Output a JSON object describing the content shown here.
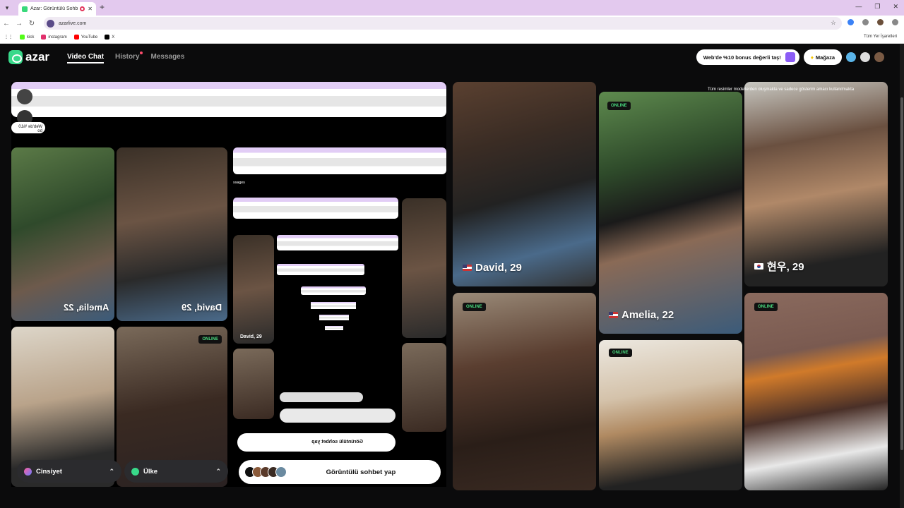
{
  "browser": {
    "tab_title": "Azar: Görüntülü Sohbet & R",
    "url": "azarlive.com",
    "bookmarks": [
      {
        "label": "kick",
        "color": "#53fc18"
      },
      {
        "label": "instagram",
        "color": "#e1306c"
      },
      {
        "label": "YouTube",
        "color": "#ff0000"
      },
      {
        "label": "X",
        "color": "#000000"
      }
    ],
    "all_bookmarks": "Tüm Yer İşaretleri"
  },
  "header": {
    "logo_text": "azar",
    "nav": [
      {
        "label": "Video Chat",
        "active": true
      },
      {
        "label": "History",
        "active": false,
        "dot": true
      },
      {
        "label": "Messages",
        "active": false
      }
    ],
    "bonus_label": "Web'de %10 bonus değerli taş!",
    "shop_label": "Mağaza"
  },
  "cards": {
    "online_label": "ONLINE",
    "david": "David, 29",
    "amelia": "Amelia, 22",
    "hyunwoo": "현우, 29",
    "disclaimer": "Tüm resimler modellerden oluşmakta ve sadece gösterim amacı kullanılmakta"
  },
  "controls": {
    "gender_label": "Cinsiyet",
    "country_label": "Ülke",
    "cta_label": "Görüntülü sohbet yap"
  },
  "mirror": {
    "bonus_flipped": "Web'de %10 bo",
    "david_flipped": "David, 29",
    "amelia_flipped": "Amelia, 22",
    "david_small": "David, 29",
    "cta_flipped": "Görüntülü sohbet yap",
    "messages_small": "ssages"
  },
  "colors": {
    "online": "#4ade80",
    "brand": "#38d98a",
    "background": "#0b0b0c"
  }
}
